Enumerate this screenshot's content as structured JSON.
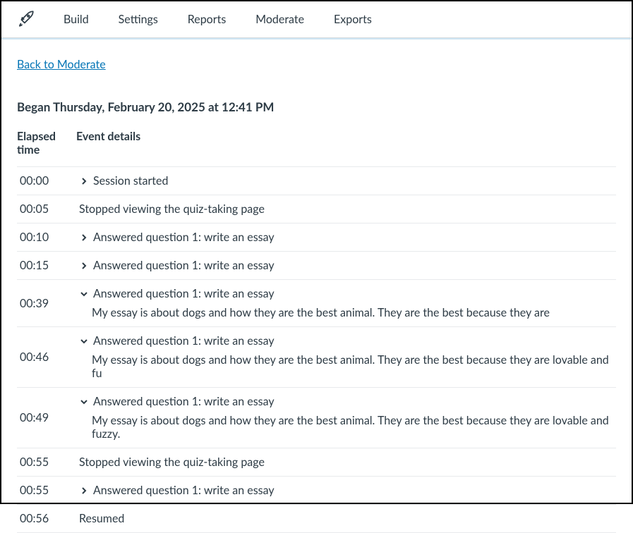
{
  "nav": {
    "items": [
      {
        "label": "Build",
        "name": "nav-build"
      },
      {
        "label": "Settings",
        "name": "nav-settings"
      },
      {
        "label": "Reports",
        "name": "nav-reports"
      },
      {
        "label": "Moderate",
        "name": "nav-moderate"
      },
      {
        "label": "Exports",
        "name": "nav-exports"
      }
    ]
  },
  "back_link": "Back to Moderate",
  "began_text": "Began Thursday, February 20, 2025 at 12:41 PM",
  "columns": {
    "time": "Elapsed time",
    "details": "Event details"
  },
  "events": [
    {
      "time": "00:00",
      "title": "Session started",
      "expand": "right"
    },
    {
      "time": "00:05",
      "title": "Stopped viewing the quiz-taking page",
      "expand": "none"
    },
    {
      "time": "00:10",
      "title": "Answered question 1: write an essay",
      "expand": "right"
    },
    {
      "time": "00:15",
      "title": "Answered question 1: write an essay",
      "expand": "right"
    },
    {
      "time": "00:39",
      "title": "Answered question 1: write an essay",
      "expand": "down",
      "detail": "My essay is about dogs and how they are the best animal. They are the best because they are"
    },
    {
      "time": "00:46",
      "title": "Answered question 1: write an essay",
      "expand": "down",
      "detail": "My essay is about dogs and how they are the best animal. They are the best because they are lovable and fu"
    },
    {
      "time": "00:49",
      "title": "Answered question 1: write an essay",
      "expand": "down",
      "detail": "My essay is about dogs and how they are the best animal. They are the best because they are lovable and fuzzy."
    },
    {
      "time": "00:55",
      "title": "Stopped viewing the quiz-taking page",
      "expand": "none"
    },
    {
      "time": "00:55",
      "title": "Answered question 1: write an essay",
      "expand": "right"
    },
    {
      "time": "00:56",
      "title": "Resumed",
      "expand": "none"
    }
  ]
}
